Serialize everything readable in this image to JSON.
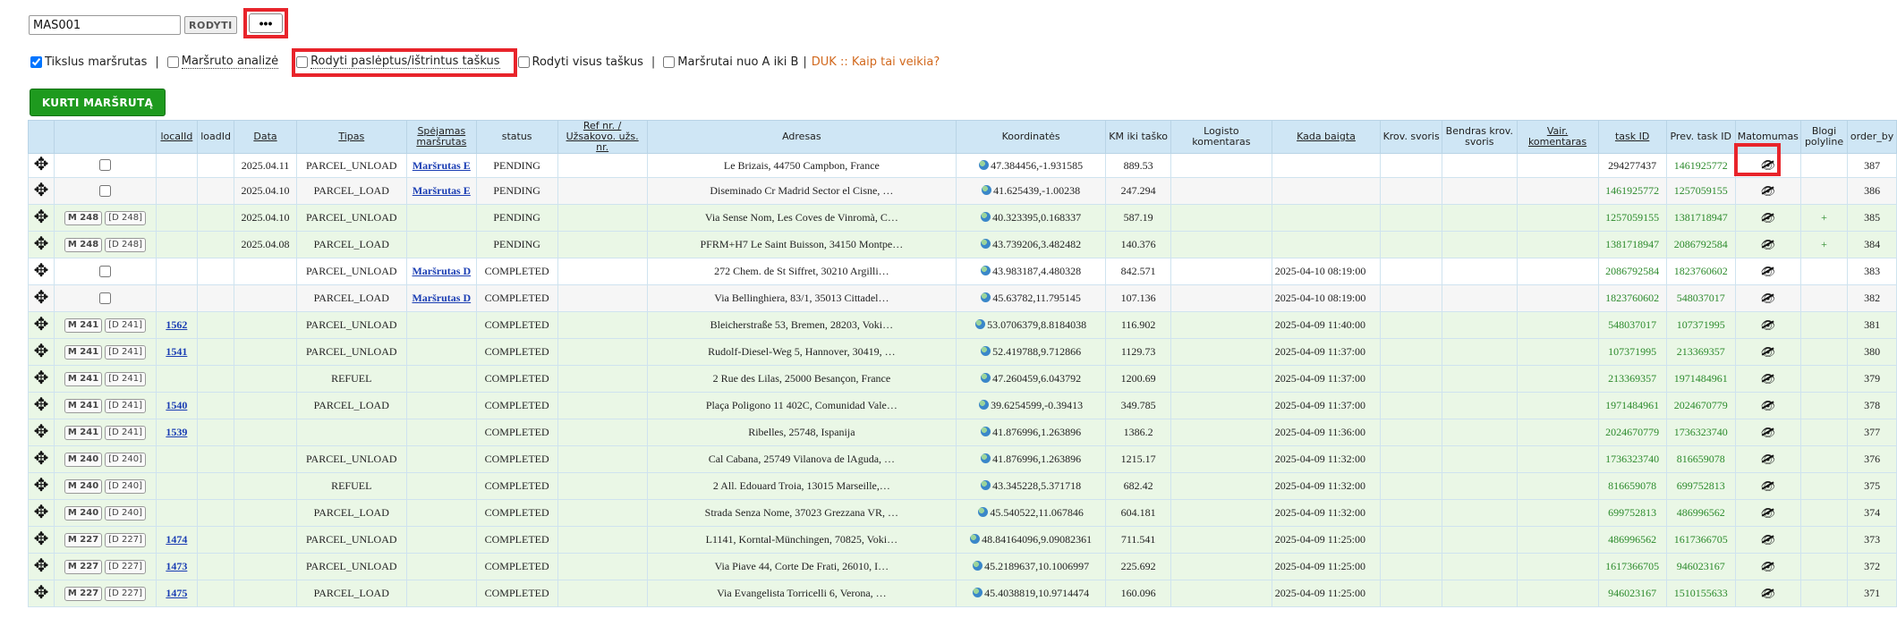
{
  "route_input": {
    "value": "MAS001"
  },
  "show_button_label": "RODYTI",
  "more_button_label": "•••",
  "options": {
    "exact_route": {
      "label": "Tikslus maršrutas",
      "checked": true
    },
    "route_analysis": {
      "label": "Maršruto analizė",
      "checked": false
    },
    "show_hidden": {
      "label": "Rodyti paslėptus/ištrintus taškus",
      "checked": false
    },
    "show_all": {
      "label": "Rodyti visus taškus",
      "checked": false
    },
    "routes_a_to_b": {
      "label": "Maršrutai nuo A iki B",
      "checked": false
    },
    "duk_link": "DUK :: Kaip tai veikia?"
  },
  "create_route_label": "KURTI MARŠRUTĄ",
  "table": {
    "headers": [
      "",
      "",
      "localId",
      "loadId",
      "Data",
      "Tipas",
      "Spėjamas maršrutas",
      "status",
      "Ref nr. / Užsakovo. užs. nr.",
      "Adresas",
      "Koordinatės",
      "KM iki taško",
      "Logisto komentaras",
      "Kada baigta",
      "Krov. svoris",
      "Bendras krov. svoris",
      "Vair. komentaras",
      "task ID",
      "Prev. task ID",
      "Matomumas",
      "Blogi polyline",
      "order_by"
    ],
    "rows": [
      {
        "style": "white",
        "checkbox": true,
        "m": "",
        "d": "",
        "localId": "",
        "date": "2025.04.11",
        "type": "PARCEL_UNLOAD",
        "guess": "Maršrutas E",
        "status": "PENDING",
        "address": "Le Brizais, 44750 Campbon, France",
        "coords": "47.384456,-1.931585",
        "km": "889.53",
        "done": "",
        "task": "294277437",
        "prev": "1461925772",
        "prevGreen": true,
        "taskGreen": false,
        "bad": "",
        "order": "387"
      },
      {
        "style": "gray",
        "checkbox": true,
        "m": "",
        "d": "",
        "localId": "",
        "date": "2025.04.10",
        "type": "PARCEL_LOAD",
        "guess": "Maršrutas E",
        "status": "PENDING",
        "address": "Diseminado Cr Madrid Sector el Cisne, …",
        "coords": "41.625439,-1.00238",
        "km": "247.294",
        "done": "",
        "task": "1461925772",
        "prev": "1257059155",
        "prevGreen": true,
        "taskGreen": true,
        "bad": "",
        "order": "386"
      },
      {
        "style": "green",
        "checkbox": false,
        "m": "M 248",
        "d": "D 248",
        "localId": "",
        "date": "2025.04.10",
        "type": "PARCEL_UNLOAD",
        "guess": "",
        "status": "PENDING",
        "address": "Via Sense Nom, Les Coves de Vinromà, C…",
        "coords": "40.323395,0.168337",
        "km": "587.19",
        "done": "",
        "task": "1257059155",
        "prev": "1381718947",
        "prevGreen": true,
        "taskGreen": true,
        "bad": "+",
        "order": "385"
      },
      {
        "style": "green",
        "checkbox": false,
        "m": "M 248",
        "d": "D 248",
        "localId": "",
        "date": "2025.04.08",
        "type": "PARCEL_LOAD",
        "guess": "",
        "status": "PENDING",
        "address": "PFRM+H7 Le Saint Buisson, 34150 Montpe…",
        "coords": "43.739206,3.482482",
        "km": "140.376",
        "done": "",
        "task": "1381718947",
        "prev": "2086792584",
        "prevGreen": true,
        "taskGreen": true,
        "bad": "+",
        "order": "384"
      },
      {
        "style": "white",
        "checkbox": true,
        "m": "",
        "d": "",
        "localId": "",
        "date": "",
        "type": "PARCEL_UNLOAD",
        "guess": "Maršrutas D",
        "status": "COMPLETED",
        "address": "272 Chem. de St Siffret, 30210 Argilli…",
        "coords": "43.983187,4.480328",
        "km": "842.571",
        "done": "2025-04-10 08:19:00",
        "task": "2086792584",
        "prev": "1823760602",
        "prevGreen": true,
        "taskGreen": true,
        "bad": "",
        "order": "383"
      },
      {
        "style": "gray",
        "checkbox": true,
        "m": "",
        "d": "",
        "localId": "",
        "date": "",
        "type": "PARCEL_LOAD",
        "guess": "Maršrutas D",
        "status": "COMPLETED",
        "address": "Via Bellinghiera, 83/1, 35013 Cittadel…",
        "coords": "45.63782,11.795145",
        "km": "107.136",
        "done": "2025-04-10 08:19:00",
        "task": "1823760602",
        "prev": "548037017",
        "prevGreen": true,
        "taskGreen": true,
        "bad": "",
        "order": "382"
      },
      {
        "style": "green",
        "checkbox": false,
        "m": "M 241",
        "d": "D 241",
        "localId": "1562",
        "date": "",
        "type": "PARCEL_UNLOAD",
        "guess": "",
        "status": "COMPLETED",
        "address": "Bleicherstraße 53, Bremen, 28203, Voki…",
        "coords": "53.0706379,8.8184038",
        "km": "116.902",
        "done": "2025-04-09 11:40:00",
        "task": "548037017",
        "prev": "107371995",
        "prevGreen": true,
        "taskGreen": true,
        "bad": "",
        "order": "381"
      },
      {
        "style": "green",
        "checkbox": false,
        "m": "M 241",
        "d": "D 241",
        "localId": "1541",
        "date": "",
        "type": "PARCEL_UNLOAD",
        "guess": "",
        "status": "COMPLETED",
        "address": "Rudolf-Diesel-Weg 5, Hannover, 30419, …",
        "coords": "52.419788,9.712866",
        "km": "1129.73",
        "done": "2025-04-09 11:37:00",
        "task": "107371995",
        "prev": "213369357",
        "prevGreen": true,
        "taskGreen": true,
        "bad": "",
        "order": "380"
      },
      {
        "style": "green",
        "checkbox": false,
        "m": "M 241",
        "d": "D 241",
        "localId": "",
        "date": "",
        "type": "REFUEL",
        "guess": "",
        "status": "COMPLETED",
        "address": "2 Rue des Lilas, 25000 Besançon, France",
        "coords": "47.260459,6.043792",
        "km": "1200.69",
        "done": "2025-04-09 11:37:00",
        "task": "213369357",
        "prev": "1971484961",
        "prevGreen": true,
        "taskGreen": true,
        "bad": "",
        "order": "379"
      },
      {
        "style": "green",
        "checkbox": false,
        "m": "M 241",
        "d": "D 241",
        "localId": "1540",
        "date": "",
        "type": "PARCEL_LOAD",
        "guess": "",
        "status": "COMPLETED",
        "address": "Plaça Poligono 11 402C, Comunidad Vale…",
        "coords": "39.6254599,-0.39413",
        "km": "349.785",
        "done": "2025-04-09 11:37:00",
        "task": "1971484961",
        "prev": "2024670779",
        "prevGreen": true,
        "taskGreen": true,
        "bad": "",
        "order": "378"
      },
      {
        "style": "green",
        "checkbox": false,
        "m": "M 241",
        "d": "D 241",
        "localId": "1539",
        "date": "",
        "type": "",
        "guess": "",
        "status": "COMPLETED",
        "address": "Ribelles, 25748, Ispanija",
        "coords": "41.876996,1.263896",
        "km": "1386.2",
        "done": "2025-04-09 11:36:00",
        "task": "2024670779",
        "prev": "1736323740",
        "prevGreen": true,
        "taskGreen": true,
        "bad": "",
        "order": "377"
      },
      {
        "style": "green",
        "checkbox": false,
        "m": "M 240",
        "d": "D 240",
        "localId": "",
        "date": "",
        "type": "PARCEL_UNLOAD",
        "guess": "",
        "status": "COMPLETED",
        "address": "Cal Cabana, 25749 Vilanova de lAguda, …",
        "coords": "41.876996,1.263896",
        "km": "1215.17",
        "done": "2025-04-09 11:32:00",
        "task": "1736323740",
        "prev": "816659078",
        "prevGreen": true,
        "taskGreen": true,
        "bad": "",
        "order": "376"
      },
      {
        "style": "green",
        "checkbox": false,
        "m": "M 240",
        "d": "D 240",
        "localId": "",
        "date": "",
        "type": "REFUEL",
        "guess": "",
        "status": "COMPLETED",
        "address": "2 All. Edouard Troia, 13015 Marseille,…",
        "coords": "43.345228,5.371718",
        "km": "682.42",
        "done": "2025-04-09 11:32:00",
        "task": "816659078",
        "prev": "699752813",
        "prevGreen": true,
        "taskGreen": true,
        "bad": "",
        "order": "375"
      },
      {
        "style": "green",
        "checkbox": false,
        "m": "M 240",
        "d": "D 240",
        "localId": "",
        "date": "",
        "type": "PARCEL_LOAD",
        "guess": "",
        "status": "COMPLETED",
        "address": "Strada Senza Nome, 37023 Grezzana VR, …",
        "coords": "45.540522,11.067846",
        "km": "604.181",
        "done": "2025-04-09 11:32:00",
        "task": "699752813",
        "prev": "486996562",
        "prevGreen": true,
        "taskGreen": true,
        "bad": "",
        "order": "374"
      },
      {
        "style": "green",
        "checkbox": false,
        "m": "M 227",
        "d": "D 227",
        "localId": "1474",
        "date": "",
        "type": "PARCEL_UNLOAD",
        "guess": "",
        "status": "COMPLETED",
        "address": "L1141, Korntal-Münchingen, 70825, Voki…",
        "coords": "48.84164096,9.09082361",
        "km": "711.541",
        "done": "2025-04-09 11:25:00",
        "task": "486996562",
        "prev": "1617366705",
        "prevGreen": true,
        "taskGreen": true,
        "bad": "",
        "order": "373"
      },
      {
        "style": "green",
        "checkbox": false,
        "m": "M 227",
        "d": "D 227",
        "localId": "1473",
        "date": "",
        "type": "PARCEL_UNLOAD",
        "guess": "",
        "status": "COMPLETED",
        "address": "Via Piave 44, Corte De Frati, 26010, I…",
        "coords": "45.2189637,10.1006997",
        "km": "225.692",
        "done": "2025-04-09 11:25:00",
        "task": "1617366705",
        "prev": "946023167",
        "prevGreen": true,
        "taskGreen": true,
        "bad": "",
        "order": "372"
      },
      {
        "style": "green",
        "checkbox": false,
        "m": "M 227",
        "d": "D 227",
        "localId": "1475",
        "date": "",
        "type": "PARCEL_LOAD",
        "guess": "",
        "status": "COMPLETED",
        "address": "Via Evangelista Torricelli 6, Verona, …",
        "coords": "45.4038819,10.9714474",
        "km": "160.096",
        "done": "2025-04-09 11:25:00",
        "task": "946023167",
        "prev": "1510155633",
        "prevGreen": true,
        "taskGreen": true,
        "bad": "",
        "order": "371"
      }
    ]
  }
}
